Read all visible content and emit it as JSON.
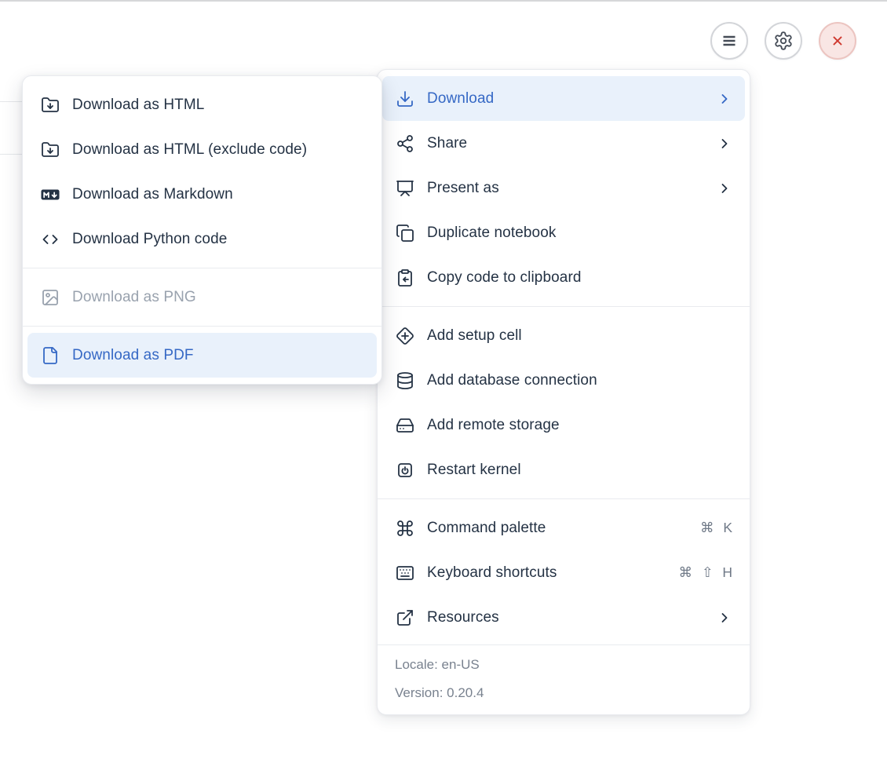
{
  "toolbar": {
    "buttons": [
      {
        "name": "notebook-menu",
        "icon": "hamburger-icon"
      },
      {
        "name": "settings",
        "icon": "gear-icon"
      },
      {
        "name": "shutdown",
        "icon": "close-icon"
      }
    ]
  },
  "main_menu": {
    "groups": [
      {
        "items": [
          {
            "label": "Download",
            "has_submenu": true,
            "active": true
          },
          {
            "label": "Share",
            "has_submenu": true
          },
          {
            "label": "Present as",
            "has_submenu": true
          },
          {
            "label": "Duplicate notebook"
          },
          {
            "label": "Copy code to clipboard"
          }
        ]
      },
      {
        "items": [
          {
            "label": "Add setup cell"
          },
          {
            "label": "Add database connection"
          },
          {
            "label": "Add remote storage"
          },
          {
            "label": "Restart kernel"
          }
        ]
      },
      {
        "items": [
          {
            "label": "Command palette",
            "shortcut": "⌘ K"
          },
          {
            "label": "Keyboard shortcuts",
            "shortcut": "⌘ ⇧ H"
          },
          {
            "label": "Resources",
            "has_submenu": true
          }
        ]
      }
    ],
    "footer": {
      "locale": "Locale: en-US",
      "version": "Version: 0.20.4"
    }
  },
  "download_submenu": {
    "groups": [
      {
        "items": [
          {
            "label": "Download as HTML"
          },
          {
            "label": "Download as HTML (exclude code)"
          },
          {
            "label": "Download as Markdown"
          },
          {
            "label": "Download Python code"
          }
        ]
      },
      {
        "items": [
          {
            "label": "Download as PNG",
            "disabled": true
          }
        ]
      },
      {
        "items": [
          {
            "label": "Download as PDF",
            "active": true
          }
        ]
      }
    ]
  },
  "colors": {
    "accent_blue": "#3568c5",
    "highlight_bg": "#e9f1fb",
    "item_text": "#243244",
    "disabled_text": "#99a2ae",
    "shortcut_text": "#6f7987",
    "footer_text": "#79828f",
    "danger_red": "#cf382e",
    "danger_bg": "#f9e6e4"
  }
}
